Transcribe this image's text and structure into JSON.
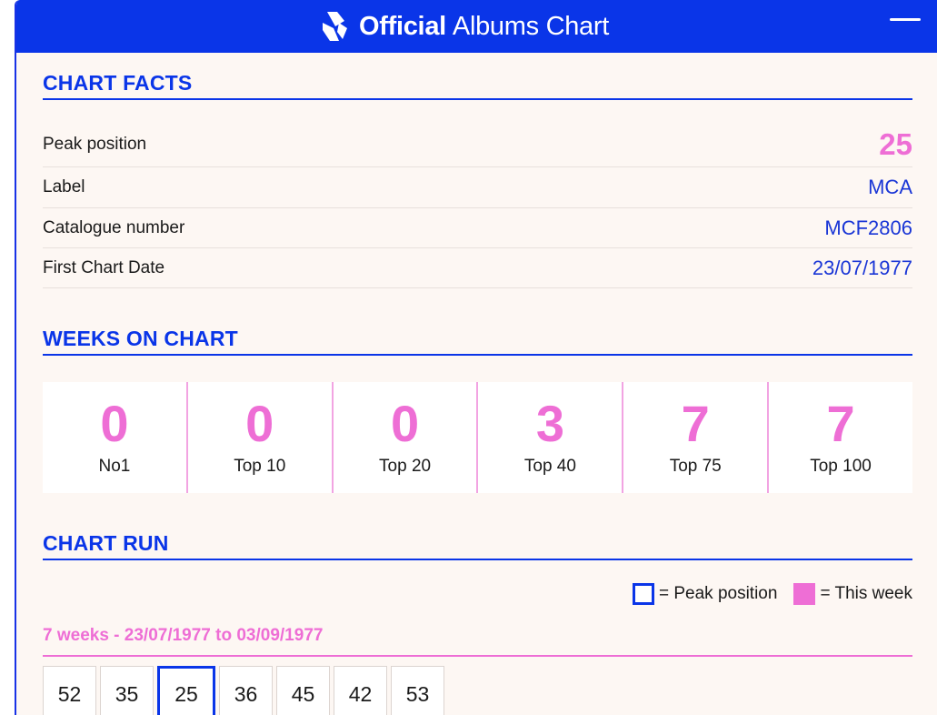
{
  "header": {
    "brand_bold": "Official",
    "brand_light": "Albums Chart",
    "menu_icon": "hamburger-menu-icon"
  },
  "chart_facts": {
    "title": "CHART FACTS",
    "rows": [
      {
        "label": "Peak position",
        "value": "25"
      },
      {
        "label": "Label",
        "value": "MCA"
      },
      {
        "label": "Catalogue number",
        "value": "MCF2806"
      },
      {
        "label": "First Chart Date",
        "value": "23/07/1977"
      }
    ]
  },
  "weeks_on_chart": {
    "title": "WEEKS ON CHART",
    "cells": [
      {
        "value": "0",
        "label": "No1"
      },
      {
        "value": "0",
        "label": "Top 10"
      },
      {
        "value": "0",
        "label": "Top 20"
      },
      {
        "value": "3",
        "label": "Top 40"
      },
      {
        "value": "7",
        "label": "Top 75"
      },
      {
        "value": "7",
        "label": "Top 100"
      }
    ]
  },
  "chart_run": {
    "title": "CHART RUN",
    "legend_peak": "= Peak position",
    "legend_this_week": "= This week",
    "range": "7 weeks - 23/07/1977 to 03/09/1977",
    "positions": [
      "52",
      "35",
      "25",
      "36",
      "45",
      "42",
      "53"
    ],
    "peak_index": 2
  },
  "colors": {
    "brand_blue": "#0a35e8",
    "accent_pink": "#ee6ed5",
    "background": "#fdf7f3"
  }
}
